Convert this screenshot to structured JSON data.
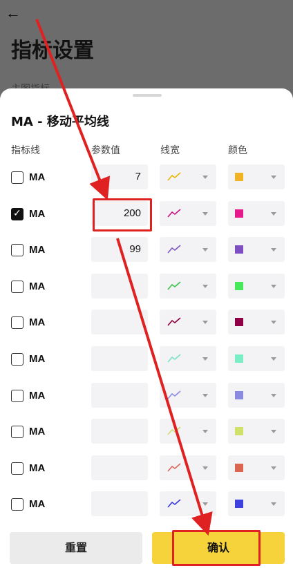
{
  "background": {
    "title": "指标设置",
    "subtitle": "主图指标"
  },
  "sheet": {
    "title": "MA - 移动平均线",
    "columns": [
      "指标线",
      "参数值",
      "线宽",
      "颜色"
    ],
    "rows": [
      {
        "label": "MA",
        "checked": false,
        "param": "7",
        "line_color": "#e6b800",
        "color": "#f0b323"
      },
      {
        "label": "MA",
        "checked": true,
        "param": "200",
        "line_color": "#c71585",
        "color": "#e5198a"
      },
      {
        "label": "MA",
        "checked": false,
        "param": "99",
        "line_color": "#7e57c2",
        "color": "#7e4fc2"
      },
      {
        "label": "MA",
        "checked": false,
        "param": "",
        "line_color": "#3cc44c",
        "color": "#47e85a"
      },
      {
        "label": "MA",
        "checked": false,
        "param": "",
        "line_color": "#8b0040",
        "color": "#8f0044"
      },
      {
        "label": "MA",
        "checked": false,
        "param": "",
        "line_color": "#79e3c8",
        "color": "#7beec5"
      },
      {
        "label": "MA",
        "checked": false,
        "param": "",
        "line_color": "#8c8ce0",
        "color": "#8a8be0"
      },
      {
        "label": "MA",
        "checked": false,
        "param": "",
        "line_color": "#c8e070",
        "color": "#cfe16a"
      },
      {
        "label": "MA",
        "checked": false,
        "param": "",
        "line_color": "#d86b5a",
        "color": "#dc6550"
      },
      {
        "label": "MA",
        "checked": false,
        "param": "",
        "line_color": "#3a3ad8",
        "color": "#3e40e0"
      }
    ],
    "reset_label": "重置",
    "confirm_label": "确认"
  },
  "icons": {
    "back": "arrow-left-icon",
    "dropdown": "chevron-down-icon",
    "check": "checkmark-icon",
    "line": "line-width-icon"
  },
  "annotation_color": "#e02121"
}
